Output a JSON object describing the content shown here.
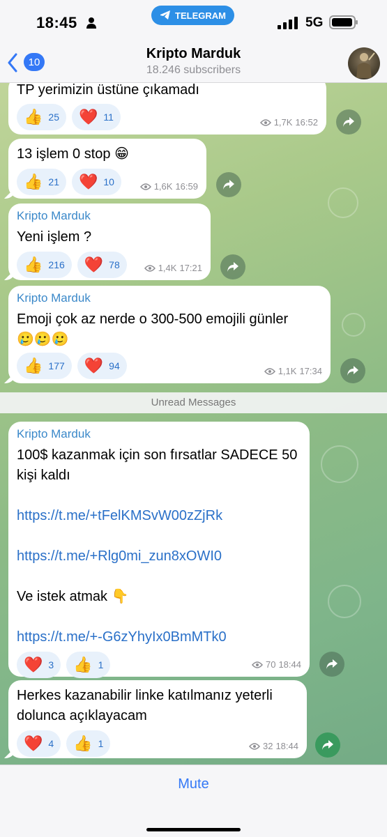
{
  "status_bar": {
    "time": "18:45",
    "app_pill": "TELEGRAM",
    "network": "5G"
  },
  "header": {
    "back_count": "10",
    "title": "Kripto Marduk",
    "subtitle": "18.246 subscribers"
  },
  "unread_label": "Unread Messages",
  "messages": [
    {
      "text": "TP yerimizin üstüne çıkamadı",
      "reactions": [
        {
          "emoji": "👍",
          "count": "25"
        },
        {
          "emoji": "❤️",
          "count": "11"
        }
      ],
      "views": "1,7K",
      "time": "16:52"
    },
    {
      "text": "13 işlem 0 stop 😁",
      "reactions": [
        {
          "emoji": "👍",
          "count": "21"
        },
        {
          "emoji": "❤️",
          "count": "10"
        }
      ],
      "views": "1,6K",
      "time": "16:59"
    },
    {
      "sender": "Kripto Marduk",
      "text": "Yeni işlem ?",
      "reactions": [
        {
          "emoji": "👍",
          "count": "216"
        },
        {
          "emoji": "❤️",
          "count": "78"
        }
      ],
      "views": "1,4K",
      "time": "17:21"
    },
    {
      "sender": "Kripto Marduk",
      "text": "Emoji çok az nerde o 300-500 emojili günler",
      "text2": "🥲🥲🥲",
      "reactions": [
        {
          "emoji": "👍",
          "count": "177"
        },
        {
          "emoji": "❤️",
          "count": "94"
        }
      ],
      "views": "1,1K",
      "time": "17:34"
    },
    {
      "sender": "Kripto Marduk",
      "text": "100$ kazanmak için son fırsatlar SADECE 50 kişi kaldı",
      "link1": "https://t.me/+tFelKMSvW00zZjRk",
      "link2": "https://t.me/+Rlg0mi_zun8xOWI0",
      "text3": "Ve istek atmak 👇",
      "link3": "https://t.me/+-G6zYhyIx0BmMTk0",
      "reactions": [
        {
          "emoji": "❤️",
          "count": "3"
        },
        {
          "emoji": "👍",
          "count": "1"
        }
      ],
      "views": "70",
      "time": "18:44"
    },
    {
      "text": "Herkes kazanabilir linke katılmanız yeterli dolunca açıklayacam",
      "reactions": [
        {
          "emoji": "❤️",
          "count": "4"
        },
        {
          "emoji": "👍",
          "count": "1"
        }
      ],
      "views": "32",
      "time": "18:44"
    }
  ],
  "footer": {
    "mute_label": "Mute"
  }
}
